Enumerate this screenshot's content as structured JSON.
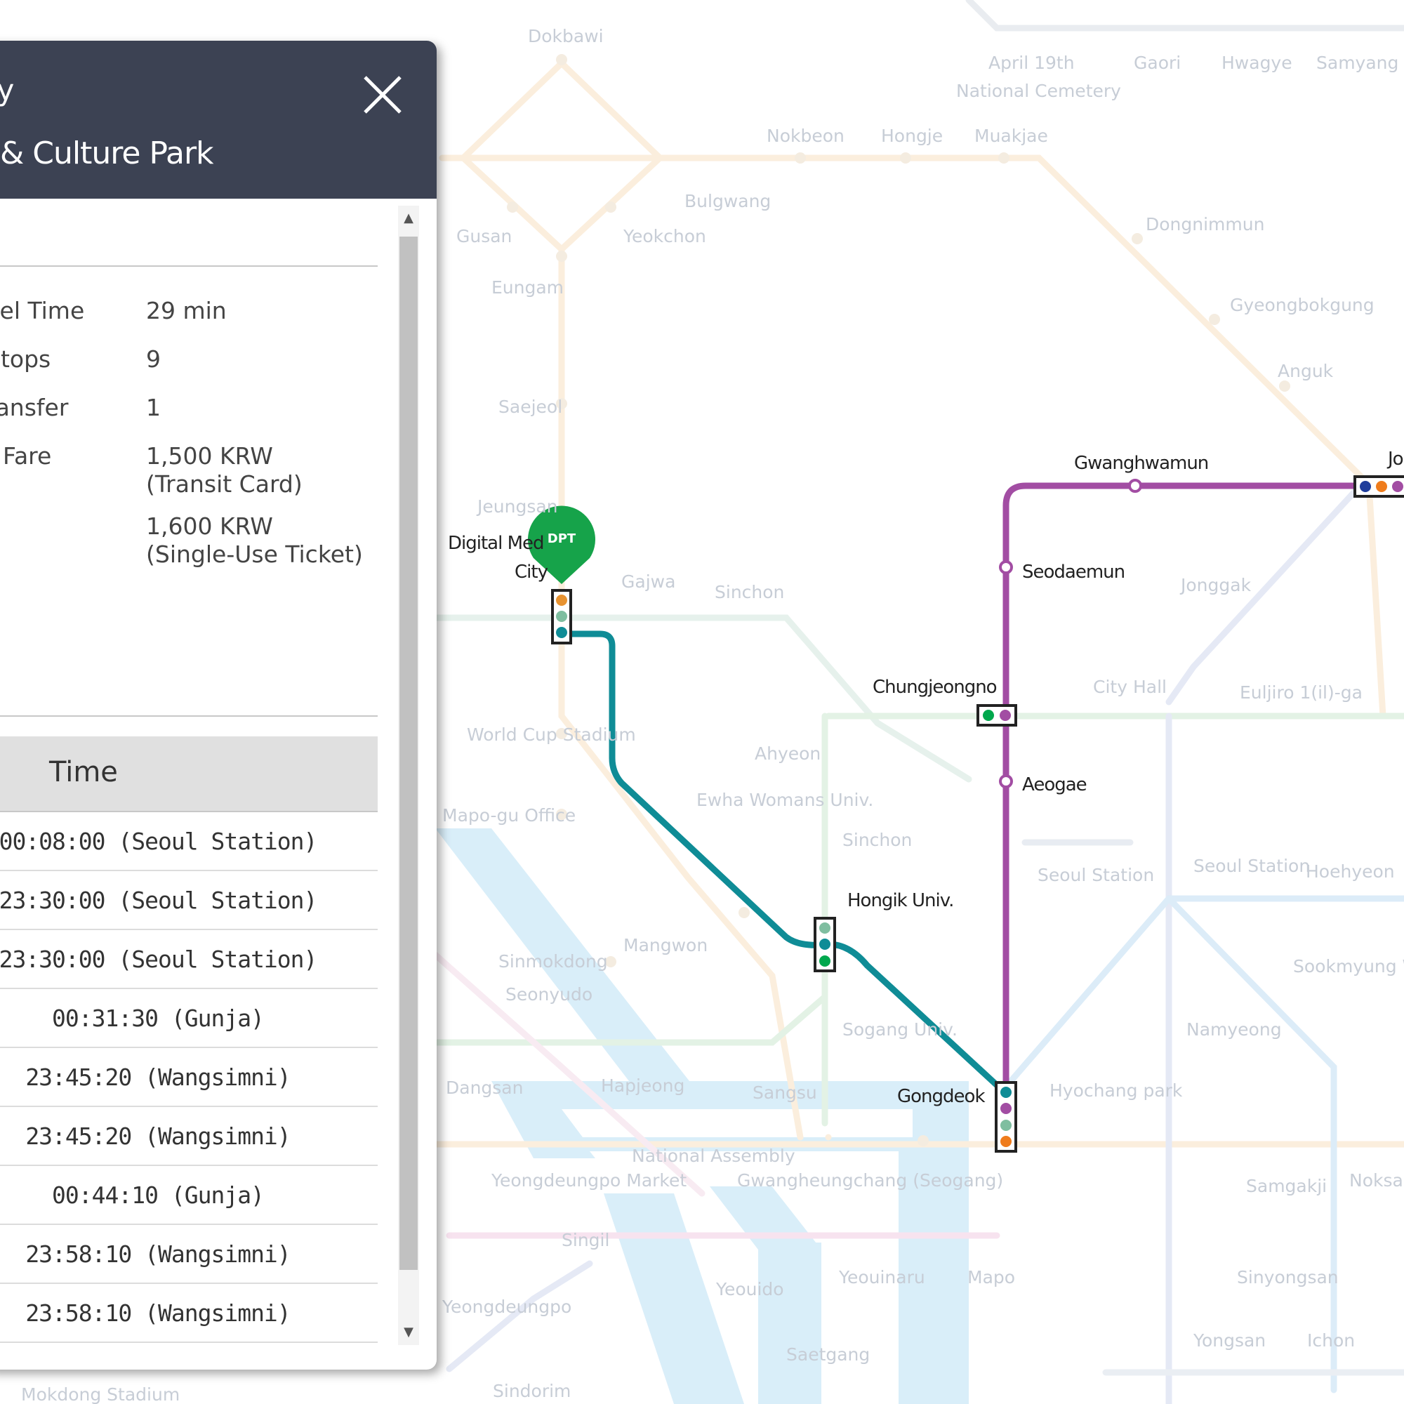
{
  "route": {
    "departure_partial": "ty",
    "arrival_partial": "& Culture Park",
    "close_icon": "close-icon"
  },
  "summary": {
    "travel_time": {
      "label": "vel Time",
      "value": "29 min"
    },
    "stops": {
      "label": "Stops",
      "value": "9"
    },
    "transfer": {
      "label": "ransfer",
      "value": "1"
    },
    "fare": {
      "label": "Fare",
      "card_amount": "1,500 KRW",
      "card_type": "(Transit Card)",
      "ticket_amount": "1,600 KRW",
      "ticket_type": "(Single-Use Ticket)"
    }
  },
  "schedule": {
    "header": "Time",
    "rows": [
      "00:08:00 (Seoul Station)",
      "23:30:00 (Seoul Station)",
      "23:30:00 (Seoul Station)",
      "00:31:30 (Gunja)",
      "23:45:20 (Wangsimni)",
      "23:45:20 (Wangsimni)",
      "00:44:10 (Gunja)",
      "23:58:10 (Wangsimni)",
      "23:58:10 (Wangsimni)"
    ]
  },
  "scroll": {
    "up_icon": "▲",
    "down_icon": "▼"
  },
  "map": {
    "departure_marker": "DPT",
    "route_stations": {
      "digital_media_city_1": "Digital Med",
      "digital_media_city_2": "City",
      "hongik": "Hongik Univ.",
      "gongdeok": "Gongdeok",
      "aeogae": "Aeogae",
      "chungjeongno": "Chungjeongno",
      "seodaemun": "Seodaemun",
      "gwanghwamun": "Gwanghwamun",
      "jongno_partial": "Jo"
    },
    "faint_stations": [
      "Dokbawi",
      "April 19th",
      "National Cemetery",
      "Gaori",
      "Hwagye",
      "Samyang",
      "Nokbeon",
      "Hongje",
      "Muakjae",
      "Bulgwang",
      "Gusan",
      "Yeokchon",
      "Dongnimmun",
      "Eungam",
      "Gyeongbokgung",
      "Anguk",
      "Saejeol",
      "Jeungsan",
      "Gajwa",
      "Sinchon",
      "Jonggak",
      "City Hall",
      "Euljiro 1(il)-ga",
      "World Cup Stadium",
      "Ahyeon",
      "Ewha Womans Univ.",
      "Mapo-gu Office",
      "Sinchon",
      "Seoul Station",
      "Seoul Station",
      "Hoehyeon",
      "Mangwon",
      "Sinmokdong",
      "Seonyudo",
      "Sogang Univ.",
      "Namyeong",
      "Sookmyung Women's Univ.",
      "Dangsan",
      "Hapjeong",
      "Sangsu",
      "Hyochang park",
      "National Assembly",
      "Gwangheungchang (Seogang)",
      "Yeongdeungpo Market",
      "Samgakji",
      "Noksapyeong",
      "Singil",
      "Yeouinaru",
      "Mapo",
      "Yeouido",
      "Sinyongsan",
      "Yeongdeungpo",
      "Saetgang",
      "Yongsan",
      "Ichon",
      "Sindorim",
      "Mokdong Stadium"
    ],
    "colors": {
      "line5": "#8b3f96",
      "line6": "#0f8c96",
      "line2": "#00a84d",
      "line1": "#1f3d9b",
      "line3": "#ef7c1c",
      "gyeongui": "#77c4a3",
      "airport": "#0090d2"
    }
  }
}
